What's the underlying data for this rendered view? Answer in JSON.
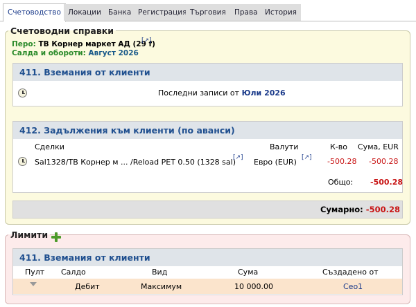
{
  "tabs": [
    {
      "label": "Счетоводство",
      "active": true
    },
    {
      "label": "Локации"
    },
    {
      "label": "Банка"
    },
    {
      "label": "Регистрация"
    },
    {
      "label": "Търговия"
    },
    {
      "label": "Права"
    },
    {
      "label": "История"
    }
  ],
  "reports": {
    "legend": "Счетоводни справки",
    "pero_label": "Перо:",
    "pero_value": "ТВ Корнер маркет АД (29 f)",
    "period_label": "Салда и обороти:",
    "period_value": "Август 2026",
    "ext_glyph": "[↗]",
    "panel411": {
      "title": "411. Вземания от клиенти",
      "text": "Последни записи от",
      "link": "Юли 2026"
    },
    "panel412": {
      "title": "412. Задължения към клиенти (по аванси)",
      "headers": {
        "deals": "Сделки",
        "currency": "Валути",
        "qty": "К-во",
        "amount": "Сума, EUR"
      },
      "row": {
        "deal": "Sal1328/ТВ Корнер м ... /Reload PET 0.50 (1328 sal)",
        "currency": "Евро (EUR)",
        "qty": "-500.28",
        "amount": "-500.28"
      },
      "total_label": "Общо:",
      "total_value": "-500.28"
    },
    "summary_label": "Сумарно:",
    "summary_value": "-500.28"
  },
  "limits": {
    "legend": "Лимити",
    "panel_title": "411. Вземания от клиенти",
    "headers": {
      "pult": "Пулт",
      "saldo": "Салдо",
      "type": "Вид",
      "amount": "Сума",
      "created": "Създадено от"
    },
    "row": {
      "saldo": "Дебит",
      "type": "Максимум",
      "amount": "10 000.00",
      "created": "Ceo1"
    }
  },
  "colors": {
    "accent": "#1f4f8f",
    "negative": "#c81414",
    "period": "#2a8a2a"
  }
}
